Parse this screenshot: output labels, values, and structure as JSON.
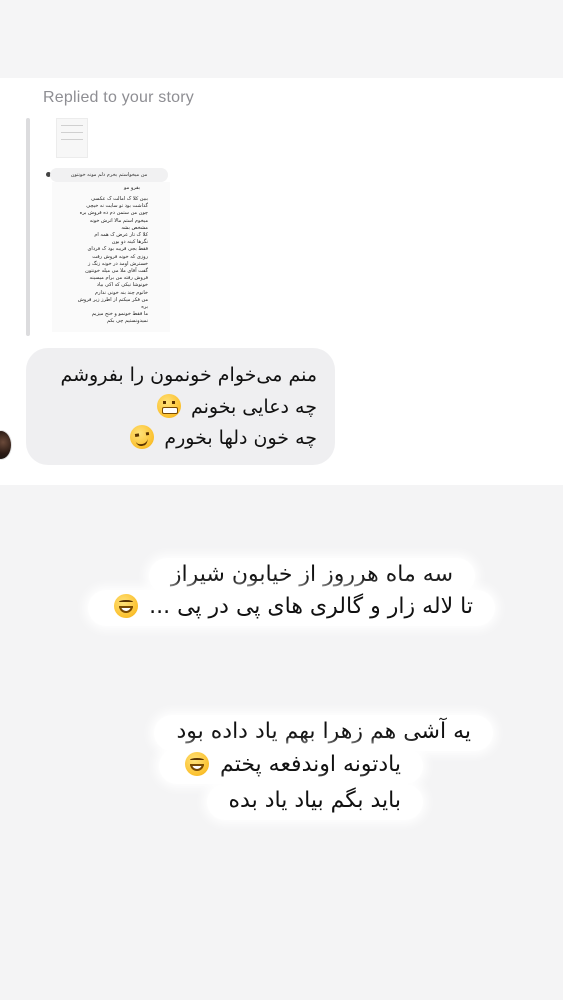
{
  "replied_label": "Replied to your story",
  "story_thumbnail": {
    "reply_text": "من میخواستم بخرم دلم مونه خونتون",
    "note_title": "بقرو مو",
    "note_lines": [
      "ببین کلا ک امالت ک عکسی",
      "گذاشت بود تو سایت نه خیچی",
      "چون من ستمن دم ده فروش بره",
      "میخوم استم مالا اترش خونه",
      "مشخص بشه",
      "کلا ک تار عرض ک همه ام",
      "نگرها کینه دو بون",
      "فقط بجی قریبه بود ک فردای",
      "روزی که خونه فروش رفت",
      "خسترش اومد در خونه زنگ ز",
      "گفت آقای ملا می میله خونتون",
      "فروش رفته من برام میسینه",
      "خونوشا نیکی که اکی بیاد",
      "خانوم چند بنه خونی ندارم",
      "من فکر میکنم از اطرز زیر فروش",
      "بره",
      "ما فقط خونمو و خنج میزیم",
      "نمیدونستیم چی بکم"
    ]
  },
  "message": {
    "lines": [
      {
        "text": "منم می‌خوام خونمون را بفروشم",
        "emoji": ""
      },
      {
        "text": "چه دعایی بخونم",
        "emoji": "grimacing-face-emoji"
      },
      {
        "text": "چه خون دلها بخورم",
        "emoji": "woozy-face-emoji"
      }
    ]
  },
  "caption_1": {
    "line1": "سه ماه هرروز از خیابون شیراز",
    "line2": "تا لاله زار و گالری های پی در پی ...",
    "line2_emoji": "grinning-face-emoji"
  },
  "caption_2": {
    "line1": "یه آشی هم زهرا بهم یاد داده بود",
    "line2": "یادتونه اوندفعه پختم",
    "line2_emoji": "grinning-face-emoji",
    "line3": "باید بگم بیاد یاد بده"
  },
  "colors": {
    "background": "#f4f4f5",
    "card": "#ffffff",
    "bubble": "#efeff1",
    "muted_text": "#8e8e93",
    "text": "#111111",
    "emoji_yellow": "#fbc02d"
  }
}
